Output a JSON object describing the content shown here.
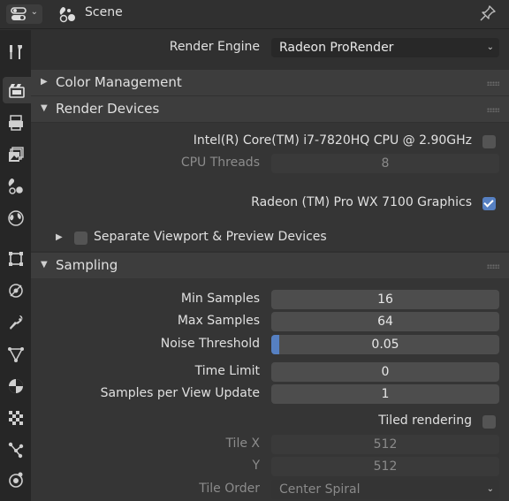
{
  "header": {
    "title": "Scene",
    "editor_icon": "properties-editor-icon",
    "scene_icon": "scene-icon",
    "pin_icon": "pin-icon"
  },
  "sidebar": {
    "tabs": [
      {
        "name": "tool",
        "icon": "tool-icon"
      },
      {
        "name": "render",
        "icon": "render-icon",
        "active": true
      },
      {
        "name": "output",
        "icon": "output-icon"
      },
      {
        "name": "view-layer",
        "icon": "view-layer-icon"
      },
      {
        "name": "scene",
        "icon": "scene-icon"
      },
      {
        "name": "world",
        "icon": "world-icon"
      },
      {
        "name": "object",
        "icon": "object-icon"
      },
      {
        "name": "physics",
        "icon": "physics-icon"
      },
      {
        "name": "modifiers",
        "icon": "wrench-icon"
      },
      {
        "name": "data",
        "icon": "mesh-data-icon"
      },
      {
        "name": "material",
        "icon": "material-icon"
      },
      {
        "name": "texture",
        "icon": "texture-icon"
      },
      {
        "name": "particles",
        "icon": "particles-icon"
      },
      {
        "name": "constraints",
        "icon": "constraints-icon"
      }
    ]
  },
  "render_engine": {
    "label": "Render Engine",
    "value": "Radeon ProRender"
  },
  "panels": {
    "color_management": {
      "title": "Color Management",
      "expanded": false
    },
    "render_devices": {
      "title": "Render Devices",
      "expanded": true,
      "cpu_label": "Intel(R) Core(TM) i7-7820HQ CPU @ 2.90GHz",
      "cpu_checked": false,
      "cpu_threads_label": "CPU Threads",
      "cpu_threads_value": "8",
      "gpu_label": "Radeon (TM) Pro WX 7100 Graphics",
      "gpu_checked": true,
      "separate_label": "Separate Viewport & Preview Devices",
      "separate_checked": false
    },
    "sampling": {
      "title": "Sampling",
      "expanded": true,
      "min_samples_label": "Min Samples",
      "min_samples_value": "16",
      "max_samples_label": "Max Samples",
      "max_samples_value": "64",
      "noise_threshold_label": "Noise Threshold",
      "noise_threshold_value": "0.05",
      "noise_threshold_fraction": 0.05,
      "time_limit_label": "Time Limit",
      "time_limit_value": "0",
      "samples_per_update_label": "Samples per View Update",
      "samples_per_update_value": "1",
      "tiled_label": "Tiled rendering",
      "tiled_checked": false,
      "tile_x_label": "Tile X",
      "tile_x_value": "512",
      "tile_y_label": "Y",
      "tile_y_value": "512",
      "tile_order_label": "Tile Order",
      "tile_order_value": "Center Spiral"
    }
  },
  "colors": {
    "accent": "#5680c2",
    "background": "#303030",
    "sidebar": "#262626",
    "panel_header": "#3d3d3d"
  }
}
